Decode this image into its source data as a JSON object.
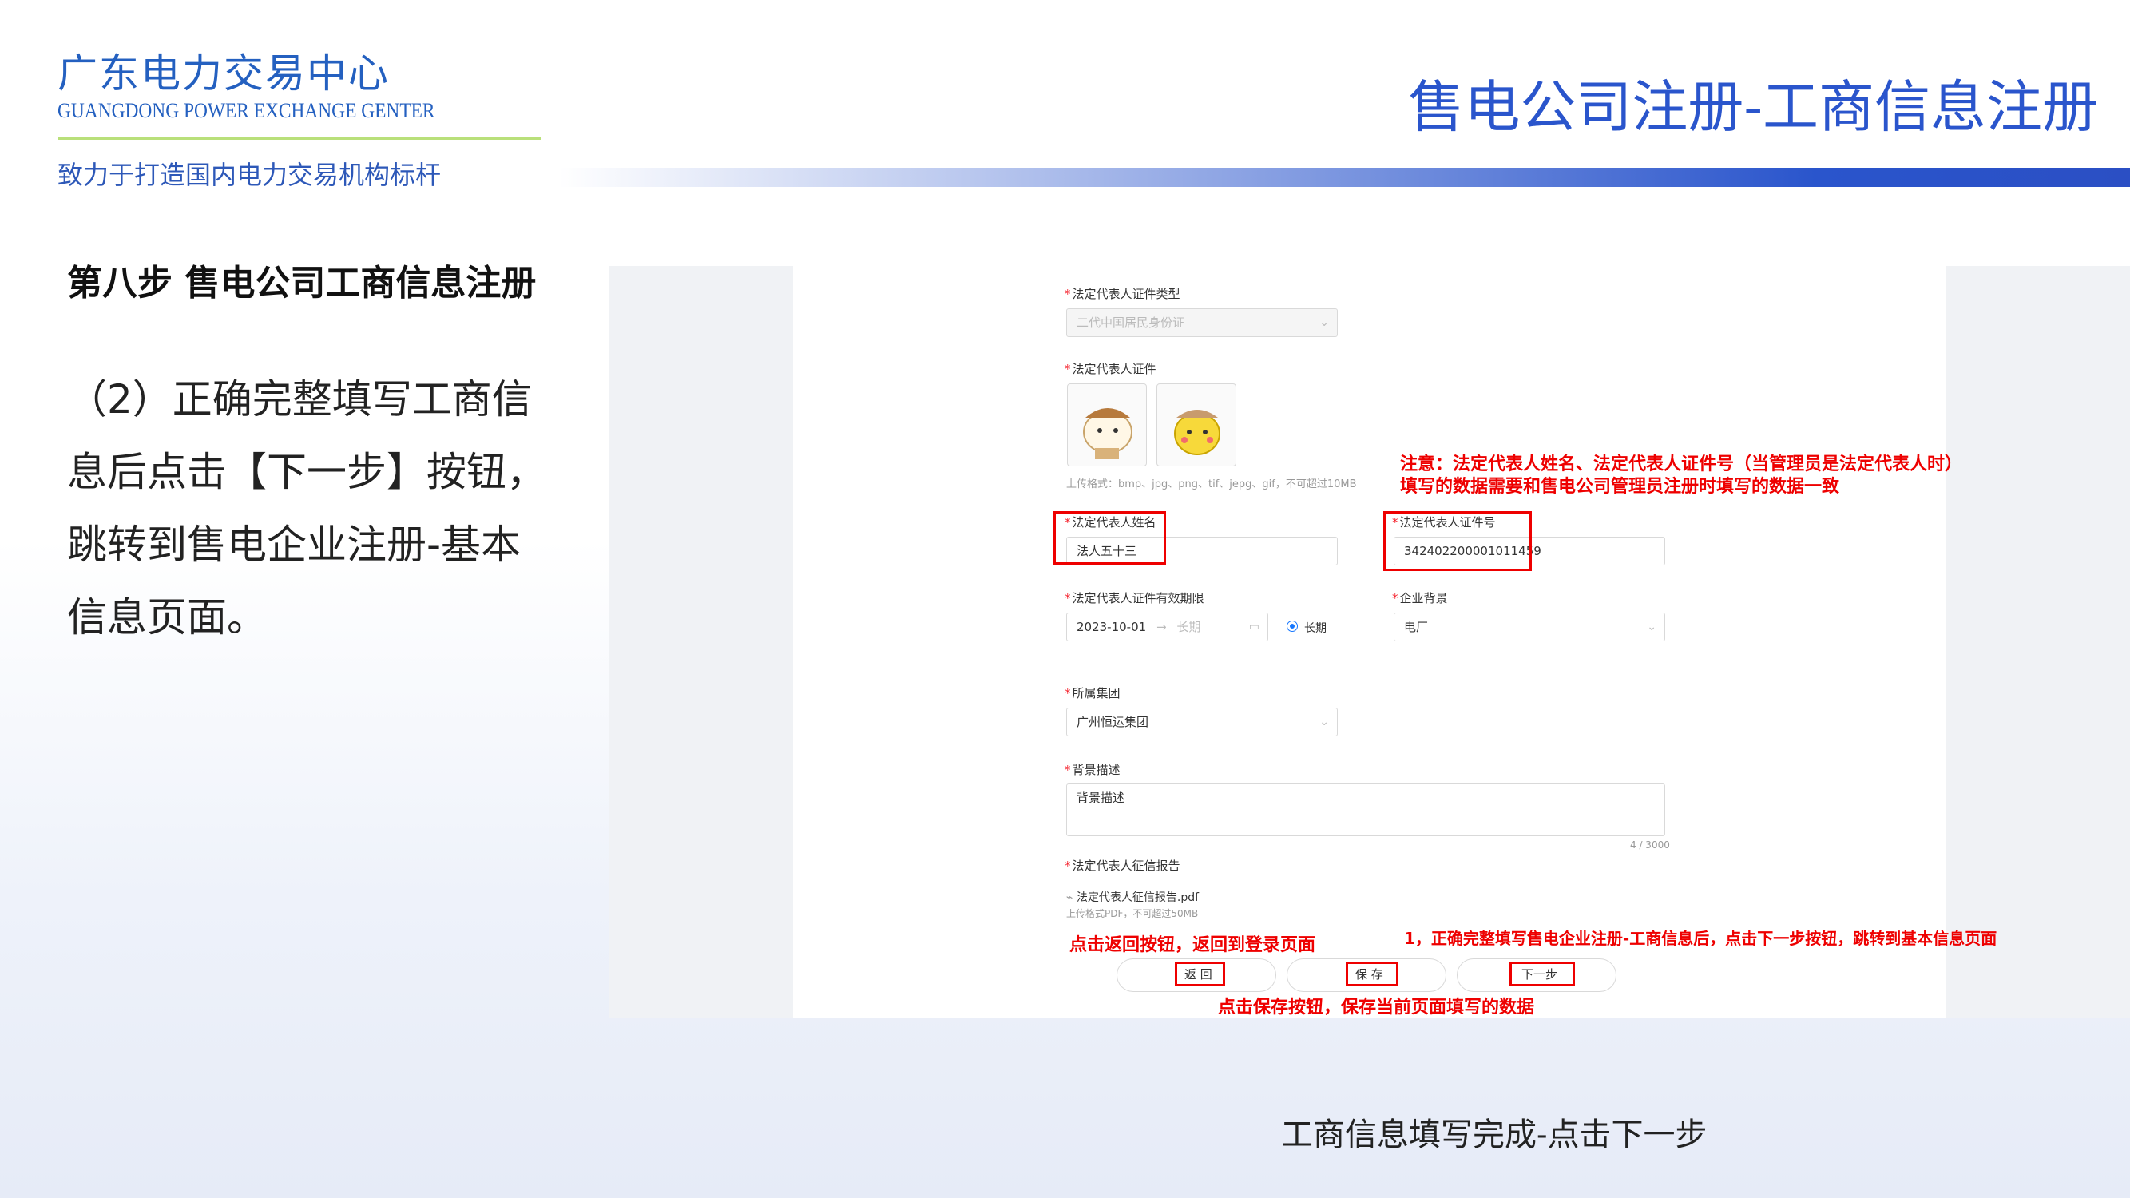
{
  "header": {
    "org_name": "广东电力交易中心",
    "org_name_en": "GUANGDONG POWER EXCHANGE GENTER",
    "slogan": "致力于打造国内电力交易机构标杆",
    "page_title": "售电公司注册-工商信息注册"
  },
  "left": {
    "step_heading": "第八步 售电公司工商信息注册",
    "step_desc": "（2）正确完整填写工商信息后点击【下一步】按钮，跳转到售电企业注册-基本信息页面。"
  },
  "form": {
    "id_type_label": "法定代表人证件类型",
    "id_type_value": "二代中国居民身份证",
    "id_doc_label": "法定代表人证件",
    "upload_hint": "上传格式：bmp、jpg、png、tif、jepg、gif，不可超过10MB",
    "rep_name_label": "法定代表人姓名",
    "rep_name_value": "法人五十三",
    "rep_id_label": "法定代表人证件号",
    "rep_id_value": "342402200001011459",
    "validity_label": "法定代表人证件有效期限",
    "validity_start": "2023-10-01",
    "validity_arrow": "→",
    "validity_end_placeholder": "长期",
    "long_term_label": "长期",
    "background_label": "企业背景",
    "background_value": "电厂",
    "group_label": "所属集团",
    "group_value": "广州恒运集团",
    "bg_desc_label": "背景描述",
    "bg_desc_value": "背景描述",
    "bg_desc_count": "4 / 3000",
    "credit_label": "法定代表人征信报告",
    "credit_file": "法定代表人征信报告.pdf",
    "credit_hint": "上传格式PDF，不可超过50MB",
    "btn_back": "返 回",
    "btn_save": "保 存",
    "btn_next": "下一步"
  },
  "annotations": {
    "note_line1": "注意：法定代表人姓名、法定代表人证件号（当管理员是法定代表人时）",
    "note_line2": "填写的数据需要和售电公司管理员注册时填写的数据一致",
    "back_note": "点击返回按钮，返回到登录页面",
    "next_note": "1，正确完整填写售电企业注册-工商信息后，点击下一步按钮，跳转到基本信息页面",
    "save_note": "点击保存按钮，保存当前页面填写的数据"
  },
  "caption": "工商信息填写完成-点击下一步",
  "colors": {
    "brand_blue": "#2a55cc",
    "annotation_red": "#e00000",
    "rule_green": "#b9e07a"
  }
}
